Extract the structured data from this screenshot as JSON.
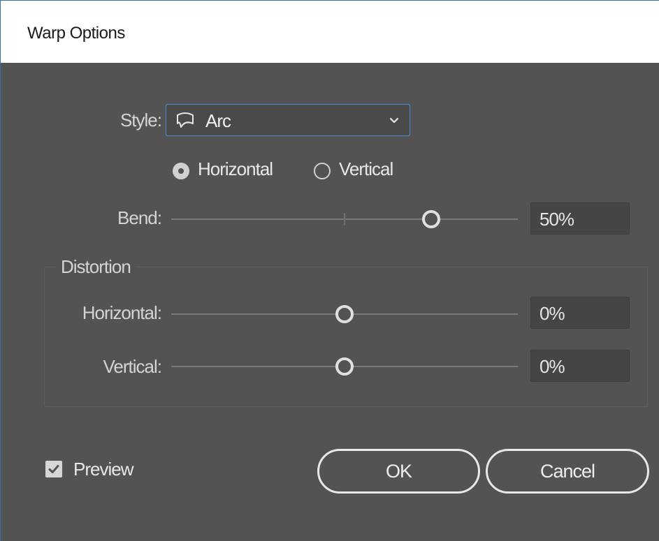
{
  "window": {
    "title": "Warp Options"
  },
  "style": {
    "label": "Style:",
    "value": "Arc",
    "icon": "arc-icon"
  },
  "orientation": {
    "options": [
      {
        "label": "Horizontal",
        "selected": true
      },
      {
        "label": "Vertical",
        "selected": false
      }
    ]
  },
  "bend": {
    "label": "Bend:",
    "value": "50%",
    "level": 50,
    "min": -100,
    "max": 100
  },
  "distortion": {
    "title": "Distortion",
    "horizontal": {
      "label": "Horizontal:",
      "value": "0%",
      "level": 0,
      "min": -100,
      "max": 100
    },
    "vertical": {
      "label": "Vertical:",
      "value": "0%",
      "level": 0,
      "min": -100,
      "max": 100
    }
  },
  "preview": {
    "label": "Preview",
    "checked": true
  },
  "buttons": {
    "ok": "OK",
    "cancel": "Cancel"
  },
  "colors": {
    "background": "#535353",
    "accent": "#4a90d9",
    "text": "#d4d4d4"
  }
}
